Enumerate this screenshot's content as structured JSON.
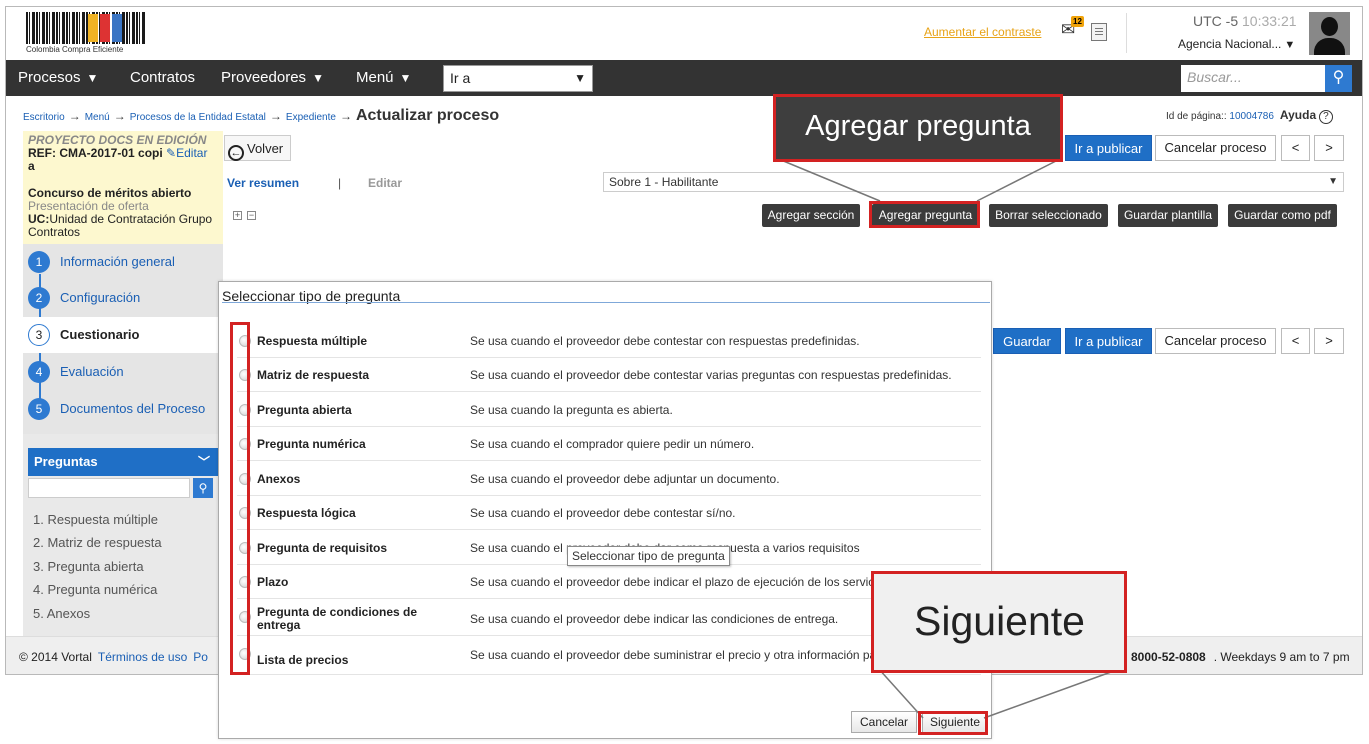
{
  "header": {
    "logo_text": "Colombia Compra Eficiente",
    "contrast_link": "Aumentar el contraste",
    "mail_count": "12",
    "utc_label": "UTC -5",
    "utc_time": "10:33:21",
    "agency": "Agencia Nacional..."
  },
  "nav": {
    "items": [
      "Procesos",
      "Contratos",
      "Proveedores",
      "Menú"
    ],
    "goto_value": "Ir a",
    "search_placeholder": "Buscar..."
  },
  "breadcrumb": {
    "items": [
      "Escritorio",
      "Menú",
      "Procesos de la Entidad Estatal",
      "Expediente"
    ],
    "current": "Actualizar proceso"
  },
  "page_id": {
    "label": "Id de página::",
    "value": "10004786",
    "help": "Ayuda"
  },
  "project": {
    "status": "PROYECTO DOCS EN EDICIÓN",
    "ref_line1": "REF: CMA-2017-01 copi",
    "ref_line2": "a",
    "edit_label": "Editar",
    "type": "Concurso de méritos abierto",
    "phase": "Presentación de oferta",
    "uc_label": "UC:",
    "uc_value": "Unidad de Contratación Grupo Contratos"
  },
  "steps": [
    {
      "num": "1",
      "label": "Información general"
    },
    {
      "num": "2",
      "label": "Configuración"
    },
    {
      "num": "3",
      "label": "Cuestionario"
    },
    {
      "num": "4",
      "label": "Evaluación"
    },
    {
      "num": "5",
      "label": "Documentos del Proceso"
    }
  ],
  "preguntas_panel": {
    "title": "Preguntas",
    "items": [
      "1. Respuesta múltiple",
      "2. Matriz de respuesta",
      "3. Pregunta abierta",
      "4. Pregunta numérica",
      "5. Anexos"
    ]
  },
  "toolbar": {
    "back": "Volver",
    "publish": "Ir a publicar",
    "cancel_process": "Cancelar proceso",
    "prev": "<",
    "next": ">",
    "save": "Guardar"
  },
  "view": {
    "summary": "Ver resumen",
    "separator": "|",
    "edit": "Editar",
    "envelope": "Sobre 1 - Habilitante"
  },
  "actions": {
    "add_section": "Agregar sección",
    "add_question": "Agregar pregunta",
    "delete_selected": "Borrar seleccionado",
    "save_template": "Guardar plantilla",
    "save_pdf": "Guardar como pdf"
  },
  "dialog": {
    "title": "Seleccionar tipo de pregunta",
    "options": [
      {
        "name": "Respuesta múltiple",
        "desc": "Se usa cuando el proveedor debe contestar con respuestas predefinidas."
      },
      {
        "name": "Matriz de respuesta",
        "desc": "Se usa cuando el proveedor debe contestar varias preguntas con respuestas predefinidas."
      },
      {
        "name": "Pregunta abierta",
        "desc": "Se usa cuando la pregunta es abierta."
      },
      {
        "name": "Pregunta numérica",
        "desc": "Se usa cuando el comprador quiere pedir un número."
      },
      {
        "name": "Anexos",
        "desc": "Se usa cuando el proveedor debe adjuntar un documento."
      },
      {
        "name": "Respuesta lógica",
        "desc": "Se usa cuando el proveedor debe contestar sí/no."
      },
      {
        "name": "Pregunta de requisitos",
        "desc": "Se usa cuando el proveedor debe dar como respuesta a varios requisitos"
      },
      {
        "name": "Plazo",
        "desc": "Se usa cuando el proveedor debe indicar el plazo de ejecución de los servicios."
      },
      {
        "name": "Pregunta de condiciones de entrega",
        "desc": "Se usa cuando el proveedor debe indicar las condiciones de entrega."
      },
      {
        "name": "Lista de precios",
        "desc": "Se usa cuando el proveedor debe suministrar el precio y otra información para los artículos."
      }
    ],
    "tooltip": "Seleccionar tipo de pregunta",
    "cancel": "Cancelar",
    "next": "Siguiente"
  },
  "callouts": {
    "add_question": "Agregar pregunta",
    "next": "Siguiente"
  },
  "footer": {
    "copyright": "© 2014 Vortal",
    "terms": "Términos de uso",
    "po": "Po",
    "phone": "8000-52-0808",
    "hours": ". Weekdays 9 am to 7 pm"
  },
  "colors": {
    "accent": "#1f6fc6",
    "nav_bg": "#333333",
    "annotation": "#d32222",
    "project_bg": "#fdf8cf"
  }
}
